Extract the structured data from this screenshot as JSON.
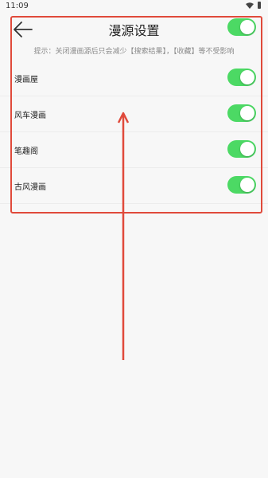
{
  "status_bar": {
    "time": "11:09",
    "icons": [
      "wifi-icon",
      "battery-icon"
    ]
  },
  "header": {
    "back_icon": "arrow-left-icon",
    "title": "漫源设置",
    "master_toggle_on": true
  },
  "hint": "提示：关闭漫画源后只会减少【搜索结果】，【收藏】等不受影响",
  "sources": [
    {
      "label": "漫画屋",
      "enabled": true
    },
    {
      "label": "风车漫画",
      "enabled": true
    },
    {
      "label": "笔趣阁",
      "enabled": true
    },
    {
      "label": "古风漫画",
      "enabled": true
    }
  ],
  "colors": {
    "toggle_on": "#4cd964",
    "annotation": "#e04a3b",
    "background": "#f7f7f7"
  }
}
